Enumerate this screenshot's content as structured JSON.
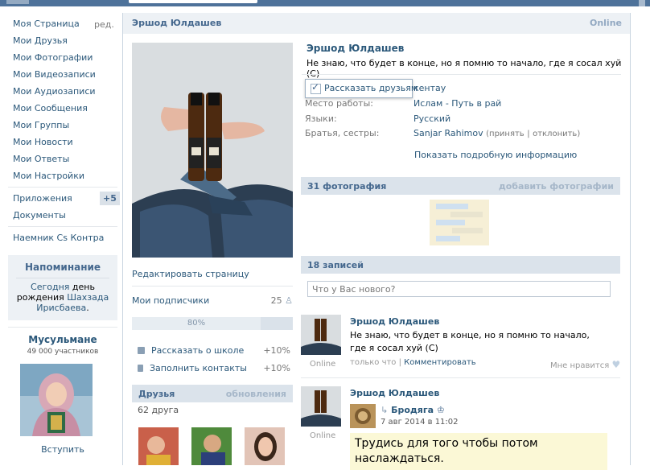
{
  "nav": {
    "items": [
      {
        "label": "Моя Страница"
      },
      {
        "label": "Мои Друзья"
      },
      {
        "label": "Мои Фотографии"
      },
      {
        "label": "Мои Видеозаписи"
      },
      {
        "label": "Мои Аудиозаписи"
      },
      {
        "label": "Мои Сообщения"
      },
      {
        "label": "Мои Группы"
      },
      {
        "label": "Мои Новости"
      },
      {
        "label": "Мои Ответы"
      },
      {
        "label": "Мои Настройки"
      }
    ],
    "edit_label": "ред.",
    "apps_label": "Приложения",
    "apps_badge": "+5",
    "docs_label": "Документы",
    "custom_label": "Наемник Cs Контра"
  },
  "reminder": {
    "title": "Напоминание",
    "today": "Сегодня",
    "day": "день",
    "birthday": "рождения",
    "person": "Шахзада Ирисбаева",
    "dot": "."
  },
  "group": {
    "name": "Мусульмане",
    "members": "49 000 участников",
    "join": "Вступить"
  },
  "header": {
    "name": "Эршод Юлдашев",
    "status": "Online"
  },
  "left_col": {
    "edit_page": "Редактировать страницу",
    "subscribers": "Мои подписчики",
    "subscribers_count": "25",
    "progress_label": "80%",
    "progress_value": 0.8,
    "tell_school": "Рассказать о школе",
    "tell_school_pct": "+10%",
    "fill_contacts": "Заполнить контакты",
    "fill_contacts_pct": "+10%",
    "friends_title": "Друзья",
    "friends_updates": "обновления",
    "friends_count": "62 друга"
  },
  "profile": {
    "name": "Эршод Юлдашев",
    "status": "Не знаю, что будет в конце, но я помню то начало, где я сосал хуй (С)",
    "share_label": "Рассказать друзьям",
    "rows": [
      {
        "label": "",
        "value": "кентау"
      },
      {
        "label": "Место работы:",
        "value": "Ислам - Путь в рай"
      },
      {
        "label": "Языки:",
        "value": "Русский"
      },
      {
        "label": "Братья, сестры:",
        "value": "Sanjar Rahimov"
      }
    ],
    "accept": "(принять",
    "sep": "|",
    "decline": "отклонить)",
    "more_info": "Показать подробную информацию"
  },
  "photos": {
    "title": "31 фотография",
    "add": "добавить фотографии"
  },
  "wall": {
    "title": "18 записей",
    "placeholder": "Что у Вас нового?",
    "posts": [
      {
        "author": "Эршод Юлдашев",
        "text": "Не знаю, что будет в конце, но я помню то начало, где я сосал хуй (С)",
        "online": "Online",
        "time": "только что",
        "sep": "|",
        "comment": "Комментировать",
        "like": "Мне нравится"
      },
      {
        "author": "Эршод Юлдашев",
        "online": "Online",
        "repost_author": "Бродяга",
        "repost_date": "7 авг 2014 в 11:02",
        "quote": "Трудись для того чтобы потом наслаждаться."
      }
    ]
  },
  "colors": {
    "link": "#2b587a",
    "header_bg": "#edf1f5",
    "section_bg": "#dbe3eb",
    "topbar": "#4e729a"
  }
}
